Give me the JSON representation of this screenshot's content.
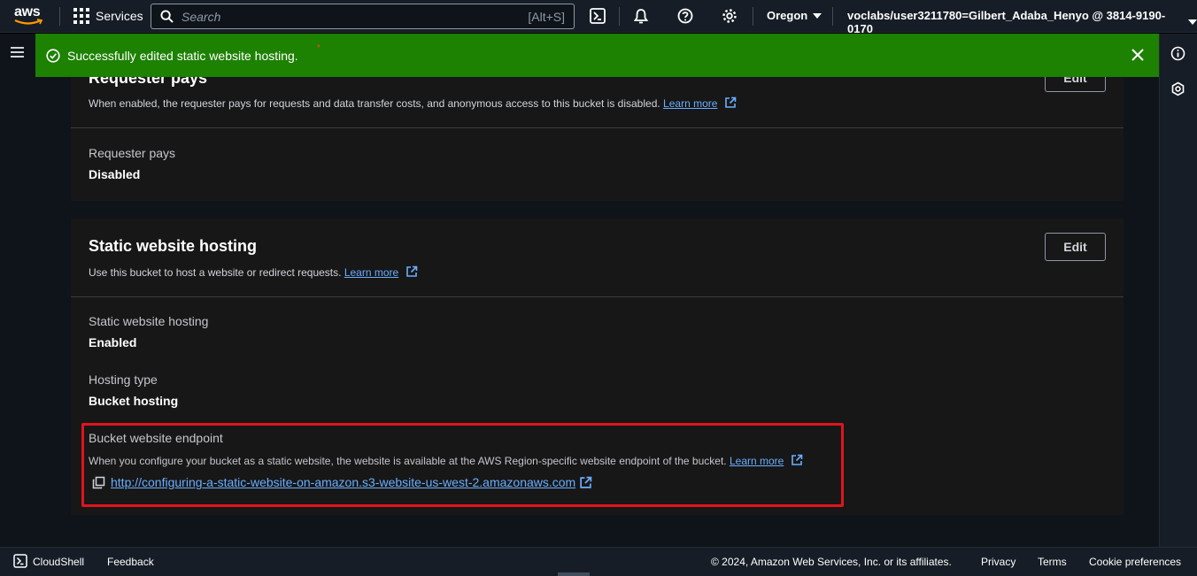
{
  "topnav": {
    "logo_text": "aws",
    "services_label": "Services",
    "search_placeholder": "Search",
    "search_shortcut": "[Alt+S]",
    "region": "Oregon",
    "account": "voclabs/user3211780=Gilbert_Adaba_Henyo @ 3814-9190-0170"
  },
  "flash": {
    "message": "Successfully edited static website hosting.",
    "marker": "*",
    "color": "#1d8102"
  },
  "requester_pays": {
    "title": "Requester pays",
    "edit_label": "Edit",
    "description": "When enabled, the requester pays for requests and data transfer costs, and anonymous access to this bucket is disabled.",
    "learn_more": "Learn more",
    "field_label": "Requester pays",
    "field_value": "Disabled"
  },
  "static_hosting": {
    "title": "Static website hosting",
    "edit_label": "Edit",
    "description": "Use this bucket to host a website or redirect requests.",
    "learn_more": "Learn more",
    "status_label": "Static website hosting",
    "status_value": "Enabled",
    "type_label": "Hosting type",
    "type_value": "Bucket hosting",
    "endpoint_label": "Bucket website endpoint",
    "endpoint_desc": "When you configure your bucket as a static website, the website is available at the AWS Region-specific website endpoint of the bucket.",
    "endpoint_learn_more": "Learn more",
    "endpoint_url": "http://configuring-a-static-website-on-amazon.s3-website-us-west-2.amazonaws.com"
  },
  "footer": {
    "cloudshell": "CloudShell",
    "feedback": "Feedback",
    "copyright": "© 2024, Amazon Web Services, Inc. or its affiliates.",
    "privacy": "Privacy",
    "terms": "Terms",
    "cookies": "Cookie preferences"
  },
  "colors": {
    "link": "#6aaeff",
    "highlight": "#e0141e",
    "panel": "#171717"
  }
}
